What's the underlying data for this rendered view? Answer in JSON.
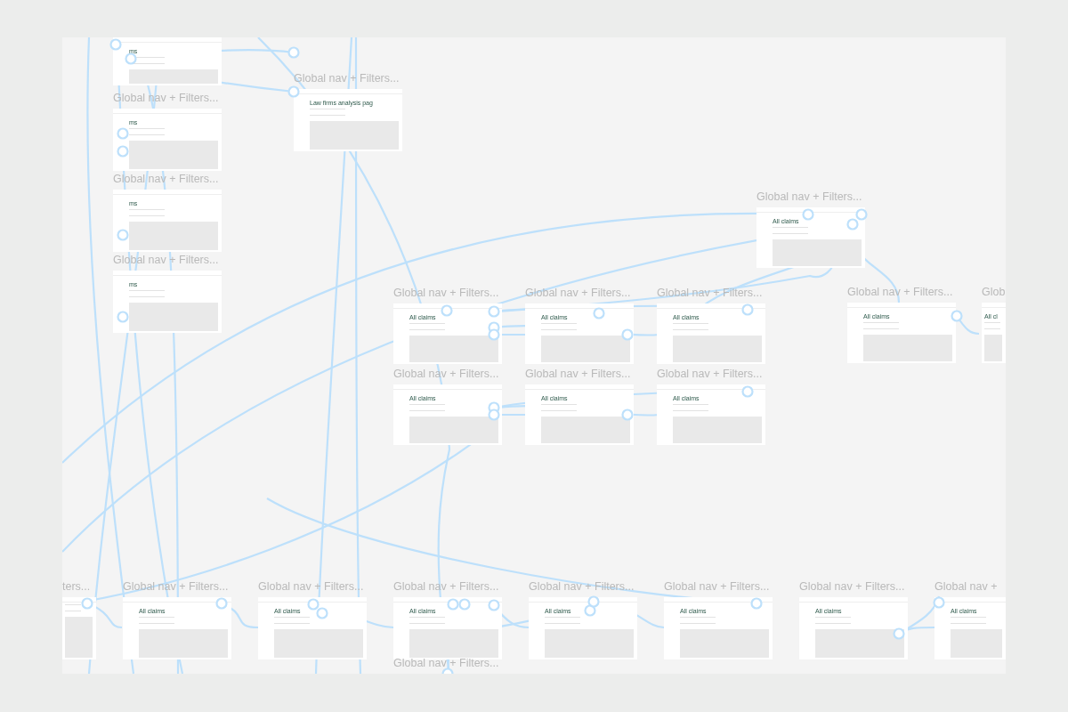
{
  "canvas": {
    "frames": [
      {
        "heading": "ms"
      },
      {
        "label": "Global nav + Filters...",
        "heading": "ms"
      },
      {
        "label": "Global nav + Filters...",
        "heading": "ms"
      },
      {
        "label": "Global nav + Filters...",
        "heading": "ms"
      },
      {
        "label": "Global nav + Filters...",
        "heading": "Law firms analysis pag"
      },
      {
        "label": "Global nav + Filters...",
        "heading": "All claims"
      },
      {
        "label": "Global nav + Filters...",
        "heading": "All claims"
      },
      {
        "label": "Global nav + Filters...",
        "heading": "All claims"
      },
      {
        "label": "Global nav + Filters...",
        "heading": "All claims"
      },
      {
        "label": "Global nav + Filters...",
        "heading": "All claims"
      },
      {
        "label": "Global nav + Filters...",
        "heading": "All claims"
      },
      {
        "label": "Global nav + Filters...",
        "heading": "All claims"
      },
      {
        "label": "Global nav + Filters...",
        "heading": "All claims"
      },
      {
        "label": "Glob",
        "heading": "All cl"
      },
      {
        "label": "ters..."
      },
      {
        "label": "Global nav + Filters...",
        "heading": "All claims"
      },
      {
        "label": "Global nav + Filters...",
        "heading": "All claims"
      },
      {
        "label": "Global nav + Filters...",
        "heading": "All claims"
      },
      {
        "label": "Global nav + Filters...",
        "heading": "All claims"
      },
      {
        "label": "Global nav + Filters...",
        "heading": "All claims"
      },
      {
        "label": "Global nav + Filters...",
        "heading": "All claims"
      },
      {
        "label": "Global nav +",
        "heading": "All claims"
      },
      {
        "label": "Global nav + Filters..."
      }
    ]
  }
}
